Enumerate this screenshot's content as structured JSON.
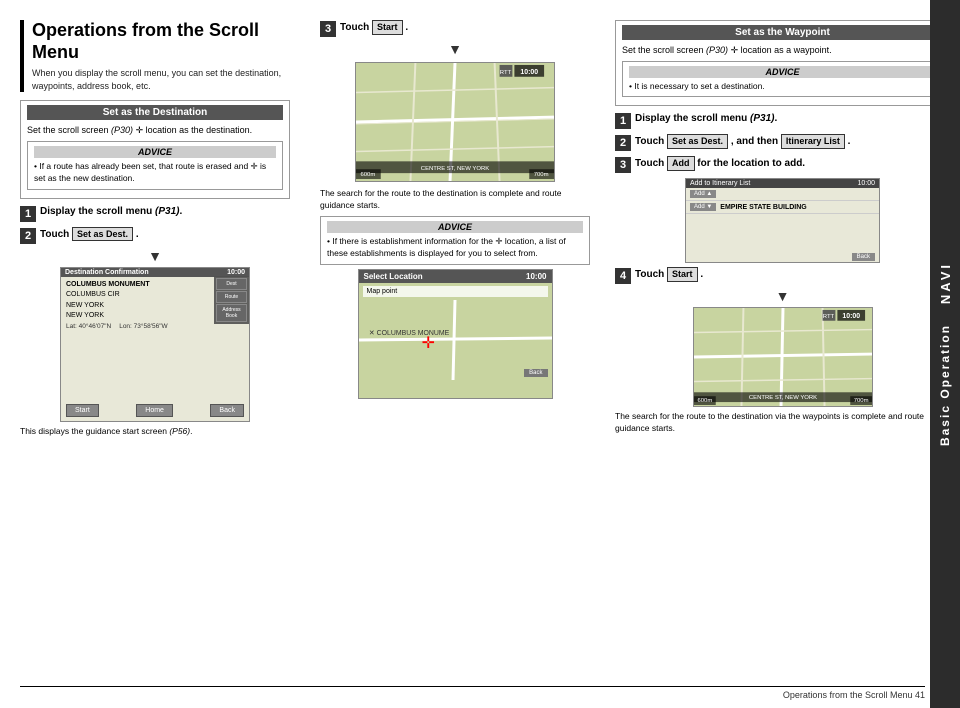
{
  "page": {
    "title": "Operations from the Scroll Menu",
    "subtitle": "When you display the scroll menu, you can set the destination, waypoints, address book, etc.",
    "page_number": "41",
    "footer_text": "Operations from the Scroll Menu   41"
  },
  "side_tab": {
    "navi_label": "NAVI",
    "basic_op_label": "Basic Operation"
  },
  "set_as_dest": {
    "header": "Set as the Destination",
    "text": "Set the scroll screen (P30) + location as the destination.",
    "advice_header": "ADVICE",
    "advice_text": "• If a route has already been set, that route is erased and + is set as the new destination."
  },
  "dest_steps": {
    "step1_label": "Display the scroll menu (P31).",
    "step2_label": "Touch",
    "step2_btn": "Set as Dest.",
    "step2_end": ".",
    "caption": "This displays the guidance start screen (P56)."
  },
  "touch_start": {
    "step3_label": "Touch",
    "step3_btn": "Start",
    "step3_end": ".",
    "caption1": "The search for the route to the destination is complete and route guidance starts.",
    "advice_header": "ADVICE",
    "advice_text": "• If there is establishment information for the + location, a list of these establishments is displayed for you to select from."
  },
  "waypoint": {
    "header": "Set as the Waypoint",
    "text": "Set the scroll screen (P30) + location as a waypoint.",
    "advice_header": "ADVICE",
    "advice_text": "• It is necessary to set a destination.",
    "step1_label": "Display the scroll menu (P31).",
    "step2_label": "Touch",
    "step2_btn": "Set as Dest.",
    "step2_and": ", and then",
    "step2_btn2": "Itinerary List",
    "step2_end": ".",
    "step3_label": "Touch",
    "step3_btn": "Add",
    "step3_end": "for the location to add.",
    "step4_label": "Touch",
    "step4_btn": "Start",
    "step4_end": ".",
    "caption": "The search for the route to the destination via the waypoints is complete and route guidance starts."
  },
  "screens": {
    "dest_confirm_title": "Destination Confirmation",
    "dest_confirm_time": "10:00",
    "dest_name": "COLUMBUS MONUMENT",
    "dest_addr1": "COLUMBUS CIR",
    "dest_addr2": "NEW YORK",
    "dest_addr3": "NEW YORK",
    "dest_lat": "40°46'07\"N",
    "dest_lon": "73°58'56\"W",
    "home_btn": "Home",
    "back_btn": "Back",
    "map_time": "10:00",
    "road_label": "CENTRE ST, NEW YORK",
    "dist_label": "600m",
    "dist_right": "700m",
    "rtt_label": "RTT",
    "select_loc_title": "Select Location",
    "map_point_label": "Map point",
    "columbus_monument": "✕ COLUMBUS MONUME",
    "itinerary_title": "Add to Itinerary List",
    "itinerary_time": "10:00",
    "empire_state": "EMPIRE STATE BUILDING",
    "add_btn": "Add"
  }
}
